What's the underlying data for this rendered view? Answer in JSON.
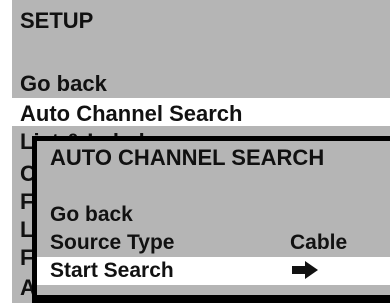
{
  "setup_menu": {
    "title": "SETUP",
    "items": [
      {
        "label": "Go back",
        "selected": false
      },
      {
        "label": "Auto Channel Search",
        "selected": true
      },
      {
        "label": "List & Labels",
        "selected": false
      },
      {
        "label": "C",
        "selected": false
      },
      {
        "label": "F",
        "selected": false
      },
      {
        "label": "L",
        "selected": false
      },
      {
        "label": "F",
        "selected": false
      },
      {
        "label": "A",
        "selected": false
      }
    ]
  },
  "dialog": {
    "title": "AUTO CHANNEL SEARCH",
    "items": [
      {
        "label": "Go back",
        "value": ""
      },
      {
        "label": "Source Type",
        "value": "Cable"
      },
      {
        "label": "Start Search",
        "value": "",
        "icon": "right-arrow-icon",
        "selected": true
      }
    ]
  },
  "colors": {
    "menu_bg": "#b5b5b5",
    "highlight": "#ffffff",
    "shadow": "#000000"
  }
}
